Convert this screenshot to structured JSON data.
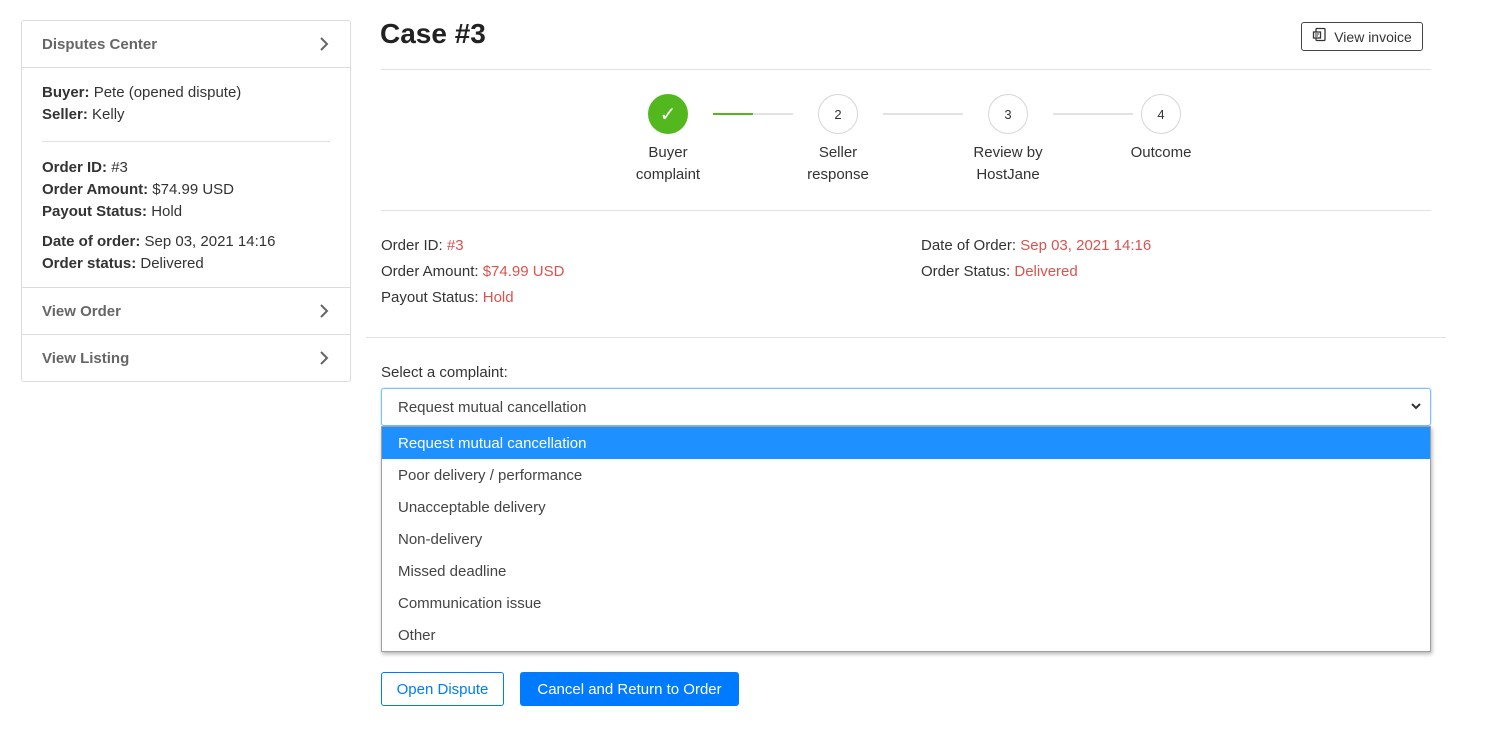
{
  "sidebar": {
    "header": "Disputes Center",
    "buyer_label": "Buyer:",
    "buyer_value": "Pete (opened dispute)",
    "seller_label": "Seller:",
    "seller_value": "Kelly",
    "order_id_label": "Order ID:",
    "order_id_value": "#3",
    "order_amount_label": "Order Amount:",
    "order_amount_value": "$74.99 USD",
    "payout_label": "Payout Status:",
    "payout_value": "Hold",
    "date_label": "Date of order:",
    "date_value": "Sep 03, 2021 14:16",
    "status_label": "Order status:",
    "status_value": "Delivered",
    "links": [
      {
        "label": "View Order"
      },
      {
        "label": "View Listing"
      }
    ]
  },
  "header": {
    "title": "Case #3",
    "invoice_button": "View invoice"
  },
  "stepper": {
    "steps": [
      {
        "marker": "✓",
        "line1": "Buyer",
        "line2": "complaint",
        "done": true
      },
      {
        "marker": "2",
        "line1": "Seller",
        "line2": "response",
        "done": false
      },
      {
        "marker": "3",
        "line1": "Review by",
        "line2": "HostJane",
        "done": false
      },
      {
        "marker": "4",
        "line1": "Outcome",
        "line2": "",
        "done": false
      }
    ]
  },
  "details": {
    "order_id_label": "Order ID:",
    "order_id_value": "#3",
    "order_amount_label": "Order Amount:",
    "order_amount_value": "$74.99 USD",
    "payout_label": "Payout Status:",
    "payout_value": "Hold",
    "date_label": "Date of Order:",
    "date_value": "Sep 03, 2021 14:16",
    "status_label": "Order Status:",
    "status_value": "Delivered"
  },
  "complaint": {
    "label": "Select a complaint:",
    "selected": "Request mutual cancellation",
    "options": [
      "Request mutual cancellation",
      "Poor delivery / performance",
      "Unacceptable delivery",
      "Non-delivery",
      "Missed deadline",
      "Communication issue",
      "Other"
    ],
    "highlighted_index": 0
  },
  "actions": {
    "open_dispute": "Open Dispute",
    "cancel_return": "Cancel and Return to Order"
  },
  "colors": {
    "accent": "#007bff",
    "success": "#52b81e",
    "value_red": "#d9534f",
    "option_highlight": "#1e90ff"
  }
}
